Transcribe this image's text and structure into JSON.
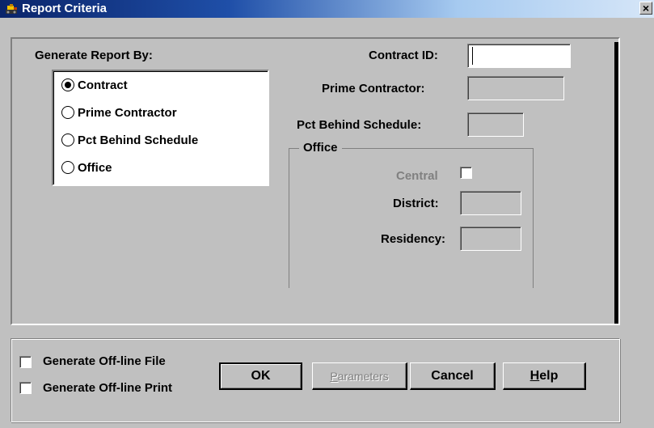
{
  "window": {
    "title": "Report Criteria",
    "close_glyph": "×"
  },
  "generate_by": {
    "label": "Generate Report By:",
    "options": [
      {
        "label": "Contract",
        "checked": true
      },
      {
        "label": "Prime Contractor",
        "checked": false
      },
      {
        "label": "Pct Behind Schedule",
        "checked": false
      },
      {
        "label": "Office",
        "checked": false
      }
    ]
  },
  "fields": {
    "contract_id": {
      "label": "Contract ID:",
      "value": ""
    },
    "prime_contractor": {
      "label": "Prime Contractor:",
      "value": ""
    },
    "pct_behind": {
      "label": "Pct Behind Schedule:",
      "value": ""
    }
  },
  "office": {
    "legend": "Office",
    "central_label": "Central",
    "district_label": "District:",
    "residency_label": "Residency:"
  },
  "bottom": {
    "offline_file": "Generate Off-line File",
    "offline_print": "Generate Off-line Print"
  },
  "buttons": {
    "ok": "OK",
    "parameters": "Parameters",
    "cancel": "Cancel",
    "help": "Help"
  },
  "colors": {
    "titlebar_start": "#0a246a",
    "face": "#c0c0c0",
    "disabled_text": "#808080"
  }
}
